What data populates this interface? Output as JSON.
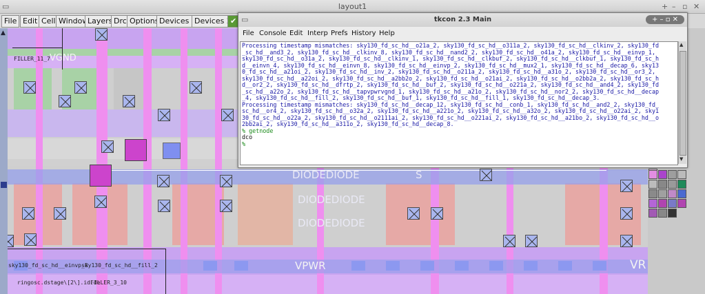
{
  "magic": {
    "title": "layout1",
    "menu": [
      "File",
      "Edit",
      "Cell",
      "Window",
      "Layers",
      "Drc",
      "Options",
      "Devices 1",
      "Devices 2"
    ],
    "labels": {
      "filler_top": "FILLER_11_7",
      "vgnd": "VGND",
      "diode1": "DIODEDIODE",
      "diode2": "DIODEDIODE",
      "diode3": "DIODEDIODE",
      "s_label": "S",
      "vpwr": "VPWR",
      "vr": "VR",
      "cell_a": "sky130_fd_sc_hd__einvp_8",
      "cell_b": "sky130_fd_sc_hd__fill_2",
      "ringosc": "ringosc.dstage\\[2\\].id.de",
      "filler_bottom": "FILLER_3_10"
    },
    "colors": {
      "canvas": "#d0d0d0",
      "pwell": "#c9a0f3",
      "diff": "#9fcf9f",
      "poly": "#e08080",
      "metal1": "#9a9cf0",
      "li": "#ef8fef",
      "metal2": "#d8a5e9"
    }
  },
  "tkcon": {
    "title": "tkcon 2.3 Main",
    "menu": [
      "File",
      "Console",
      "Edit",
      "Interp",
      "Prefs",
      "History",
      "Help"
    ],
    "lines": [
      "Processing timestamp mismatches: sky130_fd_sc_hd__o21a_2, sky130_fd_sc_hd__o311a_2, sky130_fd_sc_hd__clkinv_2, sky130_fd",
      "_sc_hd__and3_2, sky130_fd_sc_hd__clkinv_8, sky130_fd_sc_hd__nand2_2, sky130_fd_sc_hd__o41a_2, sky130_fd_sc_hd__einvp_1,",
      "sky130_fd_sc_hd__o31a_2, sky130_fd_sc_hd__clkinv_1, sky130_fd_sc_hd__clkbuf_2, sky130_fd_sc_hd__clkbuf_1, sky130_fd_sc_h",
      "d__einvn_4, sky130_fd_sc_hd__einvn_8, sky130_fd_sc_hd__einvp_2, sky130_fd_sc_hd__mux2_1, sky130_fd_sc_hd__decap_6, sky13",
      "0_fd_sc_hd__a21oi_2, sky130_fd_sc_hd__inv_2, sky130_fd_sc_hd__o211a_2, sky130_fd_sc_hd__a31o_2, sky130_fd_sc_hd__or3_2,",
      "sky130_fd_sc_hd__a22oi_2, sky130_fd_sc_hd__a2bb2o_2, sky130_fd_sc_hd__o21ai_2, sky130_fd_sc_hd__o2bb2a_2, sky130_fd_sc_h",
      "d__or2_2, sky130_fd_sc_hd__dfrtp_2, sky130_fd_sc_hd__buf_2, sky130_fd_sc_hd__o221a_2, sky130_fd_sc_hd__and4_2, sky130_fd",
      "_sc_hd__a22o_2, sky130_fd_sc_hd__tapvpwrvgnd_1, sky130_fd_sc_hd__a21o_2, sky130_fd_sc_hd__nor2_2, sky130_fd_sc_hd__decap",
      "_4, sky130_fd_sc_hd__fill_2, sky130_fd_sc_hd__buf_1, sky130_fd_sc_hd__fill_1, sky130_fd_sc_hd__decap_3.",
      "Processing timestamp mismatches: sky130_fd_sc_hd__decap_12, sky130_fd_sc_hd__conb_1, sky130_fd_sc_hd__and2_2, sky130_fd_",
      "sc_hd__or4_2, sky130_fd_sc_hd__o32a_2, sky130_fd_sc_hd__a221o_2, sky130_fd_sc_hd__a32o_2, sky130_fd_sc_hd__o22ai_2, sky1",
      "30_fd_sc_hd__o22a_2, sky130_fd_sc_hd__o2111ai_2, sky130_fd_sc_hd__o221ai_2, sky130_fd_sc_hd__a21bo_2, sky130_fd_sc_hd__o",
      "2bb2ai_2, sky130_fd_sc_hd__a311o_2, sky130_fd_sc_hd__decap_8."
    ],
    "prompt1": "% getnode",
    "output": "dco",
    "prompt2": "% "
  }
}
